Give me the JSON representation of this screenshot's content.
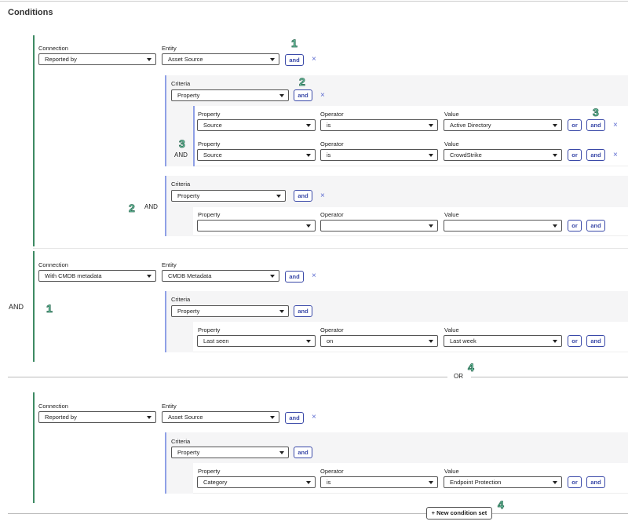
{
  "page": {
    "title": "Conditions"
  },
  "labels": {
    "connection": "Connection",
    "entity": "Entity",
    "criteria": "Criteria",
    "property": "Property",
    "operator": "Operator",
    "value": "Value"
  },
  "ops": {
    "and_upper": "AND",
    "or_upper": "OR",
    "and_btn": "and",
    "or_btn": "or"
  },
  "badges": {
    "one": "1",
    "two": "2",
    "three": "3",
    "four": "4"
  },
  "set1": {
    "conn1": {
      "connection": "Reported by",
      "entity": "Asset Source",
      "crit1": {
        "criteria": "Property",
        "rows": [
          {
            "property": "Source",
            "operator": "is",
            "value": "Active Directory"
          },
          {
            "property": "Source",
            "operator": "is",
            "value": "CrowdStrike"
          }
        ]
      },
      "crit2": {
        "criteria": "Property",
        "rows": [
          {
            "property": "",
            "operator": "",
            "value": ""
          }
        ]
      }
    },
    "conn2": {
      "connection": "With CMDB metadata",
      "entity": "CMDB Metadata",
      "crit1": {
        "criteria": "Property",
        "rows": [
          {
            "property": "Last seen",
            "operator": "on",
            "value": "Last week"
          }
        ]
      }
    }
  },
  "set2": {
    "conn1": {
      "connection": "Reported by",
      "entity": "Asset Source",
      "crit1": {
        "criteria": "Property",
        "rows": [
          {
            "property": "Category",
            "operator": "is",
            "value": "Endpoint Protection"
          }
        ]
      }
    }
  },
  "new_set_button": "+ New condition set",
  "colors": {
    "accent": "#3a49a8",
    "green_bar": "#3d8a63",
    "criteria_bar": "#8fa0e6",
    "badge": "#6fcaa6"
  }
}
